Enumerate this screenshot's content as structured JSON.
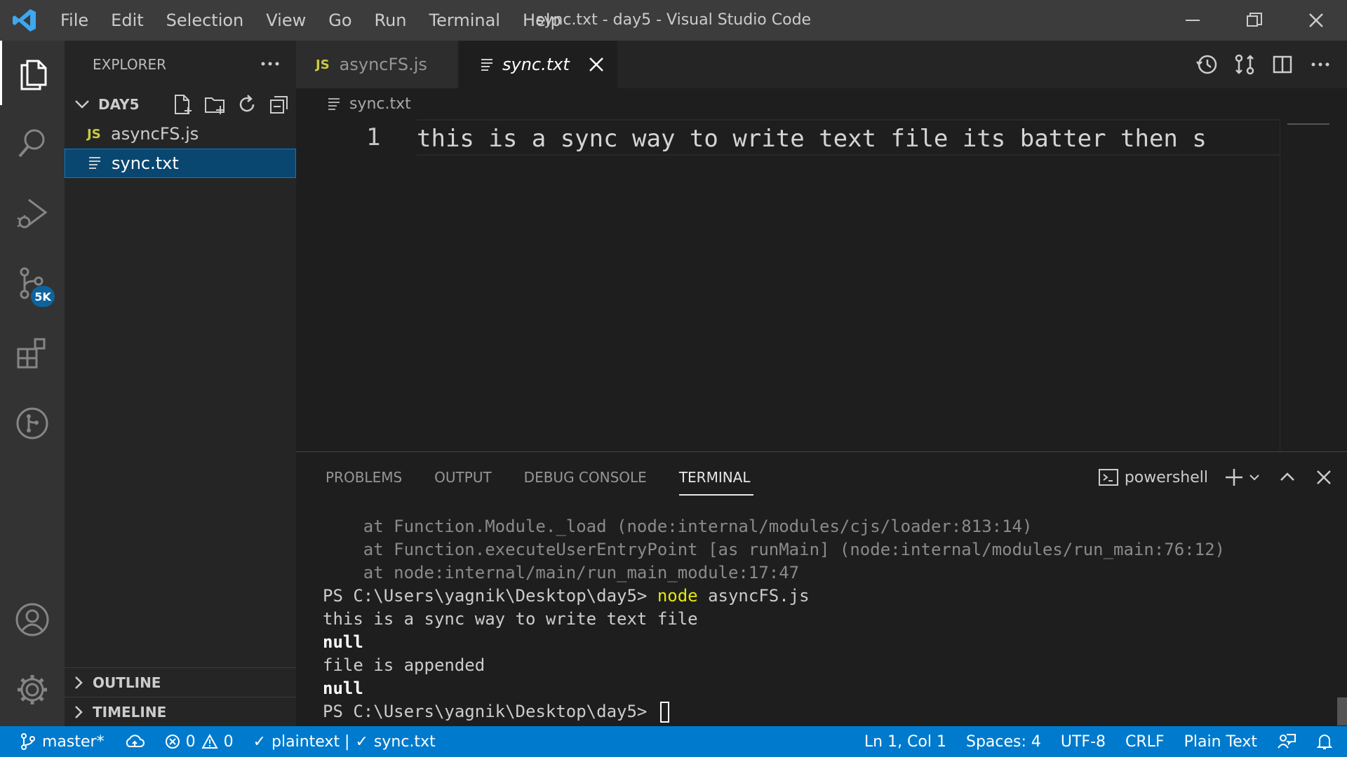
{
  "window": {
    "title": "sync.txt - day5 - Visual Studio Code"
  },
  "menu": [
    "File",
    "Edit",
    "Selection",
    "View",
    "Go",
    "Run",
    "Terminal",
    "Help"
  ],
  "activity": {
    "scm_badge": "5K"
  },
  "sidebar": {
    "title": "EXPLORER",
    "folder": "DAY5",
    "files": [
      {
        "name": "asyncFS.js",
        "icon": "JS"
      },
      {
        "name": "sync.txt",
        "icon": "text-file-icon"
      }
    ],
    "sections": [
      "OUTLINE",
      "TIMELINE"
    ]
  },
  "tabs": [
    {
      "label": "asyncFS.js",
      "icon": "JS"
    },
    {
      "label": "sync.txt"
    }
  ],
  "breadcrumb": "sync.txt",
  "editor": {
    "line_number": "1",
    "line_text": "this is a sync way to write text file its batter then s"
  },
  "panel": {
    "tabs": [
      "PROBLEMS",
      "OUTPUT",
      "DEBUG CONSOLE",
      "TERMINAL"
    ],
    "shell": "powershell",
    "terminal": {
      "trace1": "    at Function.Module._load (node:internal/modules/cjs/loader:813:14)",
      "trace2": "    at Function.executeUserEntryPoint [as runMain] (node:internal/modules/run_main:76:12)",
      "trace3": "    at node:internal/main/run_main_module:17:47",
      "prompt": "PS C:\\Users\\yagnik\\Desktop\\day5> ",
      "cmd_node": "node",
      "cmd_args": " asyncFS.js",
      "out1": "this is a sync way to write text file",
      "out2": "null",
      "out3": "file is appended",
      "out4": "null"
    }
  },
  "status": {
    "branch": "master*",
    "errors": "0",
    "warnings": "0",
    "lint1": "plaintext |",
    "lint2": "sync.txt",
    "position": "Ln 1, Col 1",
    "spaces": "Spaces: 4",
    "encoding": "UTF-8",
    "eol": "CRLF",
    "language": "Plain Text"
  },
  "colors": {
    "accent": "#007acc",
    "selection": "#094771",
    "js_icon": "#cbcb41",
    "terminal_yellow": "#e5e510"
  }
}
